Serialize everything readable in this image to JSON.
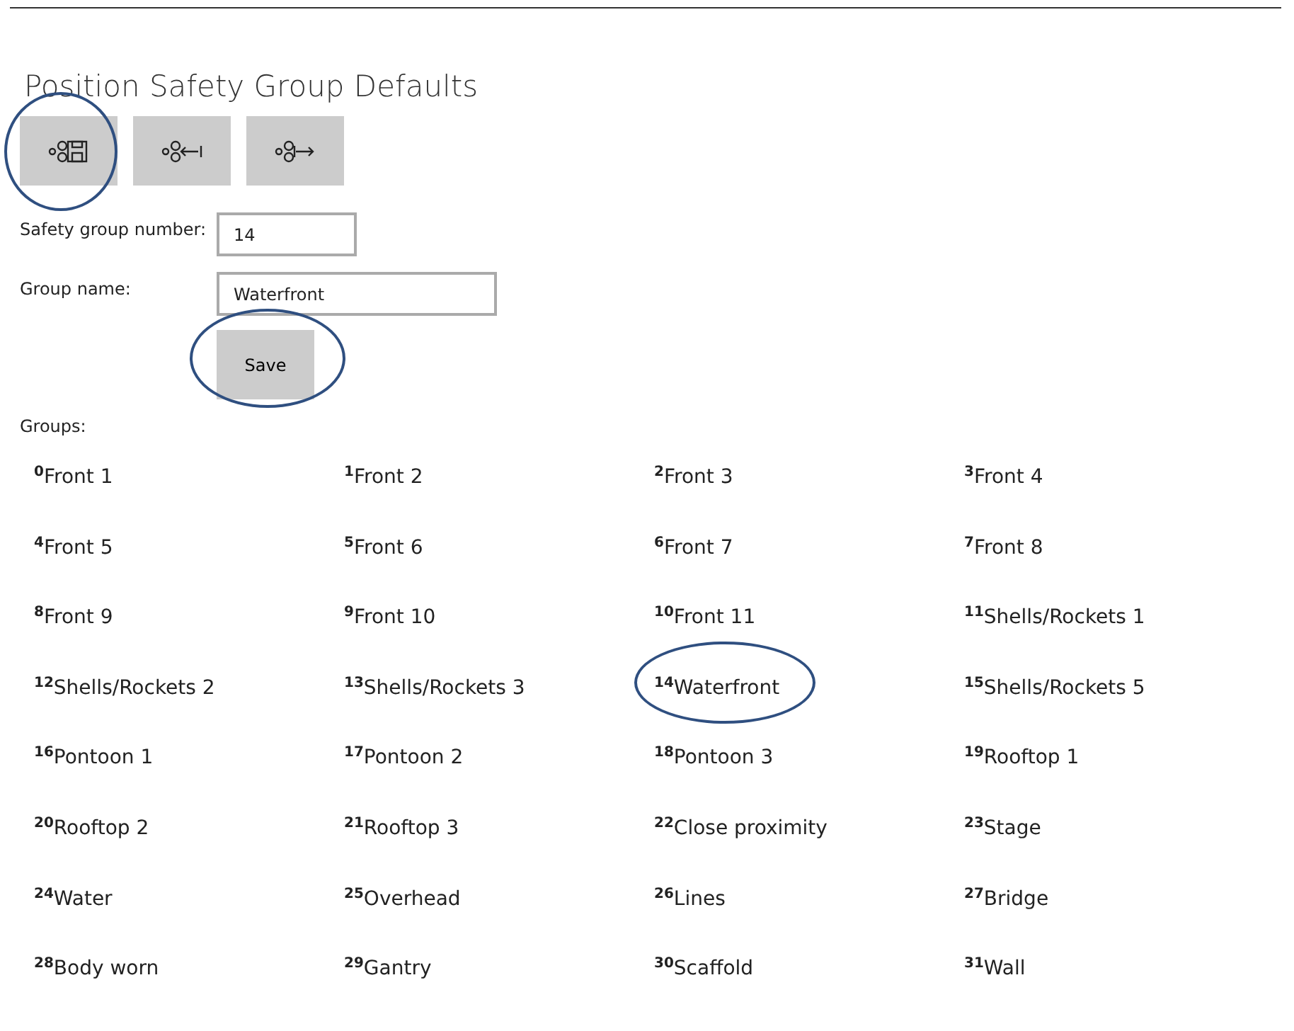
{
  "title": "Position Safety Group Defaults",
  "toolbar": [
    {
      "kind": "save",
      "circled": true
    },
    {
      "kind": "import",
      "circled": false
    },
    {
      "kind": "export",
      "circled": false
    }
  ],
  "fields": [
    {
      "label": "Safety group number:",
      "value": "14"
    },
    {
      "label": "Group name:",
      "value": "Waterfront"
    }
  ],
  "save_button": {
    "label": "Save",
    "circled": true
  },
  "groups_label": "Groups:",
  "groups": [
    {
      "index": "0",
      "name": "Front 1",
      "circled": false
    },
    {
      "index": "1",
      "name": "Front 2",
      "circled": false
    },
    {
      "index": "2",
      "name": "Front 3",
      "circled": false
    },
    {
      "index": "3",
      "name": "Front 4",
      "circled": false
    },
    {
      "index": "4",
      "name": "Front 5",
      "circled": false
    },
    {
      "index": "5",
      "name": "Front 6",
      "circled": false
    },
    {
      "index": "6",
      "name": "Front 7",
      "circled": false
    },
    {
      "index": "7",
      "name": "Front 8",
      "circled": false
    },
    {
      "index": "8",
      "name": "Front 9",
      "circled": false
    },
    {
      "index": "9",
      "name": "Front 10",
      "circled": false
    },
    {
      "index": "10",
      "name": "Front 11",
      "circled": false
    },
    {
      "index": "11",
      "name": "Shells/Rockets 1",
      "circled": false
    },
    {
      "index": "12",
      "name": "Shells/Rockets 2",
      "circled": false
    },
    {
      "index": "13",
      "name": "Shells/Rockets 3",
      "circled": false
    },
    {
      "index": "14",
      "name": "Waterfront",
      "circled": true
    },
    {
      "index": "15",
      "name": "Shells/Rockets 5",
      "circled": false
    },
    {
      "index": "16",
      "name": "Pontoon 1",
      "circled": false
    },
    {
      "index": "17",
      "name": "Pontoon 2",
      "circled": false
    },
    {
      "index": "18",
      "name": "Pontoon 3",
      "circled": false
    },
    {
      "index": "19",
      "name": "Rooftop 1",
      "circled": false
    },
    {
      "index": "20",
      "name": "Rooftop 2",
      "circled": false
    },
    {
      "index": "21",
      "name": "Rooftop 3",
      "circled": false
    },
    {
      "index": "22",
      "name": "Close proximity",
      "circled": false
    },
    {
      "index": "23",
      "name": "Stage",
      "circled": false
    },
    {
      "index": "24",
      "name": "Water",
      "circled": false
    },
    {
      "index": "25",
      "name": "Overhead",
      "circled": false
    },
    {
      "index": "26",
      "name": "Lines",
      "circled": false
    },
    {
      "index": "27",
      "name": "Bridge",
      "circled": false
    },
    {
      "index": "28",
      "name": "Body worn",
      "circled": false
    },
    {
      "index": "29",
      "name": "Gantry",
      "circled": false
    },
    {
      "index": "30",
      "name": "Scaffold",
      "circled": false
    },
    {
      "index": "31",
      "name": "Wall",
      "circled": false
    }
  ]
}
